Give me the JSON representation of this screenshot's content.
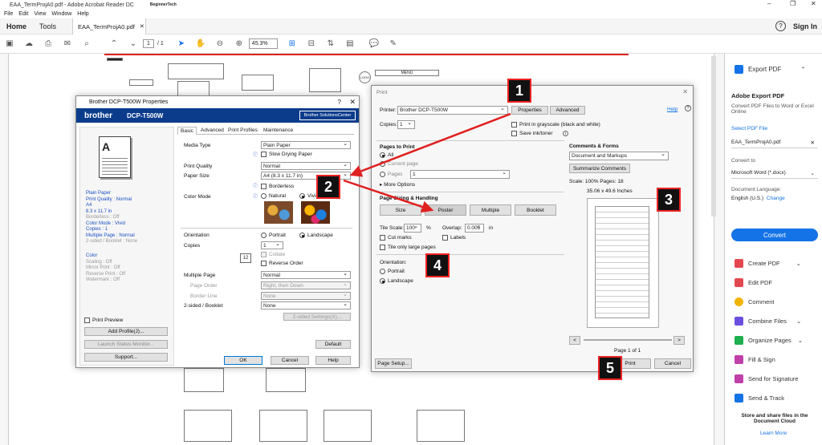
{
  "window": {
    "title": "EAA_TermProjA0.pdf - Adobe Acrobat Reader DC",
    "logo_text": "BeginnerTech"
  },
  "menu": [
    "File",
    "Edit",
    "View",
    "Window",
    "Help"
  ],
  "tabs": {
    "home": "Home",
    "tools": "Tools",
    "doc": "EAA_TermProjA0.pdf",
    "signin": "Sign In"
  },
  "toolbar": {
    "page_current": "1",
    "page_total": "/ 1",
    "zoom": "45.3%"
  },
  "pdf": {
    "menu_label": "MENU",
    "logo_label": "LOGO"
  },
  "right_pane": {
    "export_pdf": "Export PDF",
    "heading": "Adobe Export PDF",
    "desc": "Convert PDF Files to Word or Excel Online",
    "select_file": "Select PDF File",
    "file_name": "EAA_TermProjA0.pdf",
    "convert_to": "Convert to",
    "format": "Microsoft Word (*.docx)",
    "doc_lang": "Document Language:",
    "lang": "English (U.S.)",
    "change": "Change",
    "convert_btn": "Convert",
    "tools": [
      "Create PDF",
      "Edit PDF",
      "Comment",
      "Combine Files",
      "Organize Pages",
      "Fill & Sign",
      "Send for Signature",
      "Send & Track"
    ],
    "promo": "Store and share files in the Document Cloud",
    "learn_more": "Learn More"
  },
  "print": {
    "title": "Print",
    "printer_label": "Printer:",
    "printer": "Brother DCP-T500W",
    "properties": "Properties",
    "advanced": "Advanced",
    "help": "Help",
    "copies_label": "Copies:",
    "copies": "1",
    "grayscale": "Print in grayscale (black and white)",
    "save_ink": "Save ink/toner",
    "pages_to_print": "Pages to Print",
    "all": "All",
    "current_page": "Current page",
    "pages": "Pages",
    "pages_value": "1",
    "more_options": "More Options",
    "sizing": "Page Sizing & Handling",
    "size_btn": "Size",
    "poster_btn": "Poster",
    "multiple_btn": "Multiple",
    "booklet_btn": "Booklet",
    "tile_scale": "Tile Scale:",
    "tile_value": "100",
    "percent": "%",
    "overlap": "Overlap:",
    "overlap_value": "0.005",
    "in": "in",
    "cut_marks": "Cut marks",
    "labels": "Labels",
    "tile_large": "Tile only large pages",
    "orientation": "Orientation:",
    "portrait": "Portrait",
    "landscape": "Landscape",
    "comments_forms": "Comments & Forms",
    "doc_markups": "Document and Markups",
    "summarize": "Summarize Comments",
    "scale_info": "Scale: 100% Pages: 18",
    "dims": "35.06 x 49.6 Inches",
    "page_of": "Page 1 of 1",
    "page_setup": "Page Setup...",
    "print_btn": "Print",
    "cancel_btn": "Cancel"
  },
  "brother": {
    "title": "Brother DCP-T500W Properties",
    "brand": "brother",
    "model": "DCP-T500W",
    "solutions": "Brother SolutionsCenter",
    "tabs": [
      "Basic",
      "Advanced",
      "Print Profiles",
      "Maintenance"
    ],
    "media_type_label": "Media Type",
    "media_type": "Plain Paper",
    "slow_drying": "Slow Drying Paper",
    "print_quality_label": "Print Quality",
    "print_quality": "Normal",
    "paper_size_label": "Paper Size",
    "paper_size": "A4 (8.3 x 11.7 in)",
    "borderless": "Borderless",
    "color_mode_label": "Color Mode",
    "natural": "Natural",
    "vivid": "Vivid",
    "orientation_label": "Orientation",
    "portrait": "Portrait",
    "landscape": "Landscape",
    "copies_label": "Copies",
    "copies": "1",
    "collate": "Collate",
    "reverse": "Reverse Order",
    "multiple_label": "Multiple Page",
    "multiple": "Normal",
    "page_order_label": "Page Order",
    "page_order": "Right, then Down",
    "border_label": "Border Line",
    "border": "None",
    "two_sided_label": "2-sided / Booklet",
    "two_sided": "None",
    "two_sided_btn": "2-sided Settings(X)...",
    "default": "Default",
    "summary": [
      "Plain Paper",
      "Print Quality : Normal",
      "A4",
      "8.3 x 11.7 in",
      "Borderless : Off",
      "Color Mode : Vivid",
      "Copies : 1",
      "Multiple Page : Normal",
      "2-sided / Booklet : None"
    ],
    "summary2": [
      "Color",
      "Scaling : Off",
      "Mirror Print : Off",
      "Reverse Print : Off",
      "Watermark : Off"
    ],
    "print_preview": "Print Preview",
    "add_profile": "Add Profile(J)...",
    "launch_status": "Launch Status Monitor...",
    "support": "Support...",
    "ok": "OK",
    "cancel": "Cancel",
    "help": "Help"
  },
  "badges": [
    "1",
    "2",
    "3",
    "4",
    "5"
  ],
  "colors": {
    "accent": "#1473e6",
    "brother_blue": "#0b3c8c",
    "arrow": "#e02020"
  }
}
